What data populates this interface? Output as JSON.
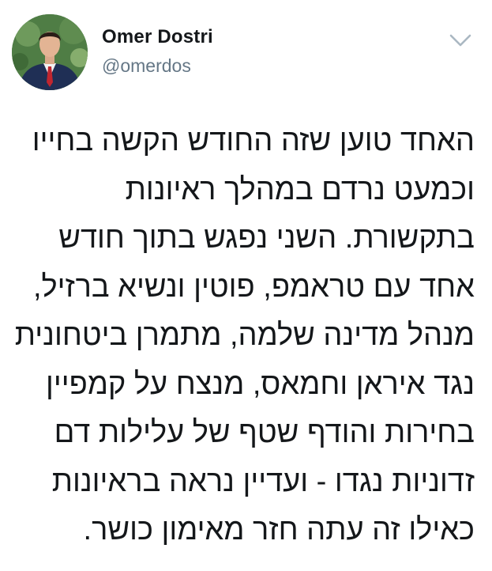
{
  "user": {
    "name": "Omer Dostri",
    "handle": "@omerdos"
  },
  "menu_icon": "chevron-down-icon",
  "tweet": {
    "lines": [
      "האחד טוען שזה החודש הקשה בחייו",
      "וכמעט נרדם במהלך ראיונות",
      "בתקשורת. השני נפגש בתוך חודש",
      "אחד עם טראמפ, פוטין ונשיא ברזיל,",
      "מנהל מדינה שלמה, מתמרן ביטחונית",
      "נגד איראן וחמאס, מנצח על קמפיין",
      "בחירות והודף שטף של עלילות דם",
      "זדוניות נגדו - ועדיין נראה בראיונות",
      "כאילו זה עתה חזר מאימון כושר."
    ]
  },
  "colors": {
    "text": "#14171a",
    "secondary": "#657786",
    "icon": "#aab8c2"
  }
}
